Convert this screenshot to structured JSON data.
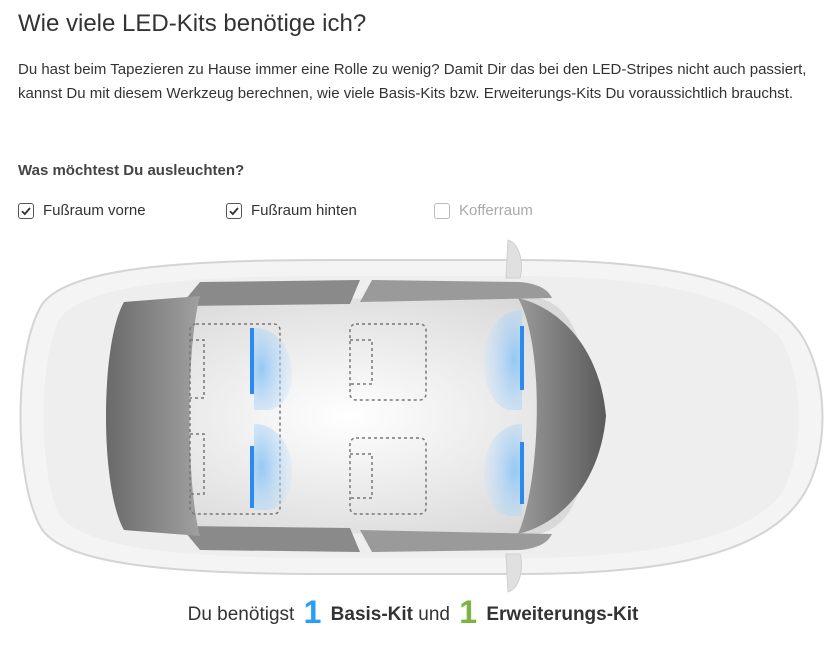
{
  "heading": "Wie viele LED-Kits benötige ich?",
  "intro": "Du hast beim Tapezieren zu Hause immer eine Rolle zu wenig? Damit Dir das bei den LED-Stripes nicht auch passiert, kannst Du mit diesem Werkzeug berechnen, wie viele Basis-Kits bzw. Erweiterungs-Kits Du voraussichtlich brauchst.",
  "question": "Was möchtest Du ausleuchten?",
  "options": [
    {
      "label": "Fußraum vorne",
      "checked": true
    },
    {
      "label": "Fußraum hinten",
      "checked": true
    },
    {
      "label": "Kofferraum",
      "checked": false
    }
  ],
  "result": {
    "prefix": "Du benötigst",
    "basis_count": "1",
    "basis_label": "Basis-Kit",
    "connector": "und",
    "ext_count": "1",
    "ext_label": "Erweiterungs-Kit",
    "basis_color": "#2a9df4",
    "ext_color": "#7cb342"
  },
  "colors": {
    "led": "#2a8af0",
    "text": "#333333"
  }
}
